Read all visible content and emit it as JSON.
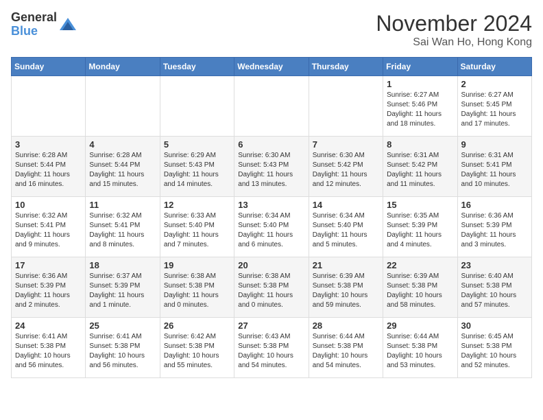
{
  "logo": {
    "general": "General",
    "blue": "Blue"
  },
  "title": {
    "month_year": "November 2024",
    "location": "Sai Wan Ho, Hong Kong"
  },
  "days_of_week": [
    "Sunday",
    "Monday",
    "Tuesday",
    "Wednesday",
    "Thursday",
    "Friday",
    "Saturday"
  ],
  "weeks": [
    [
      {
        "day": "",
        "info": ""
      },
      {
        "day": "",
        "info": ""
      },
      {
        "day": "",
        "info": ""
      },
      {
        "day": "",
        "info": ""
      },
      {
        "day": "",
        "info": ""
      },
      {
        "day": "1",
        "info": "Sunrise: 6:27 AM\nSunset: 5:46 PM\nDaylight: 11 hours and 18 minutes."
      },
      {
        "day": "2",
        "info": "Sunrise: 6:27 AM\nSunset: 5:45 PM\nDaylight: 11 hours and 17 minutes."
      }
    ],
    [
      {
        "day": "3",
        "info": "Sunrise: 6:28 AM\nSunset: 5:44 PM\nDaylight: 11 hours and 16 minutes."
      },
      {
        "day": "4",
        "info": "Sunrise: 6:28 AM\nSunset: 5:44 PM\nDaylight: 11 hours and 15 minutes."
      },
      {
        "day": "5",
        "info": "Sunrise: 6:29 AM\nSunset: 5:43 PM\nDaylight: 11 hours and 14 minutes."
      },
      {
        "day": "6",
        "info": "Sunrise: 6:30 AM\nSunset: 5:43 PM\nDaylight: 11 hours and 13 minutes."
      },
      {
        "day": "7",
        "info": "Sunrise: 6:30 AM\nSunset: 5:42 PM\nDaylight: 11 hours and 12 minutes."
      },
      {
        "day": "8",
        "info": "Sunrise: 6:31 AM\nSunset: 5:42 PM\nDaylight: 11 hours and 11 minutes."
      },
      {
        "day": "9",
        "info": "Sunrise: 6:31 AM\nSunset: 5:41 PM\nDaylight: 11 hours and 10 minutes."
      }
    ],
    [
      {
        "day": "10",
        "info": "Sunrise: 6:32 AM\nSunset: 5:41 PM\nDaylight: 11 hours and 9 minutes."
      },
      {
        "day": "11",
        "info": "Sunrise: 6:32 AM\nSunset: 5:41 PM\nDaylight: 11 hours and 8 minutes."
      },
      {
        "day": "12",
        "info": "Sunrise: 6:33 AM\nSunset: 5:40 PM\nDaylight: 11 hours and 7 minutes."
      },
      {
        "day": "13",
        "info": "Sunrise: 6:34 AM\nSunset: 5:40 PM\nDaylight: 11 hours and 6 minutes."
      },
      {
        "day": "14",
        "info": "Sunrise: 6:34 AM\nSunset: 5:40 PM\nDaylight: 11 hours and 5 minutes."
      },
      {
        "day": "15",
        "info": "Sunrise: 6:35 AM\nSunset: 5:39 PM\nDaylight: 11 hours and 4 minutes."
      },
      {
        "day": "16",
        "info": "Sunrise: 6:36 AM\nSunset: 5:39 PM\nDaylight: 11 hours and 3 minutes."
      }
    ],
    [
      {
        "day": "17",
        "info": "Sunrise: 6:36 AM\nSunset: 5:39 PM\nDaylight: 11 hours and 2 minutes."
      },
      {
        "day": "18",
        "info": "Sunrise: 6:37 AM\nSunset: 5:39 PM\nDaylight: 11 hours and 1 minute."
      },
      {
        "day": "19",
        "info": "Sunrise: 6:38 AM\nSunset: 5:38 PM\nDaylight: 11 hours and 0 minutes."
      },
      {
        "day": "20",
        "info": "Sunrise: 6:38 AM\nSunset: 5:38 PM\nDaylight: 11 hours and 0 minutes."
      },
      {
        "day": "21",
        "info": "Sunrise: 6:39 AM\nSunset: 5:38 PM\nDaylight: 10 hours and 59 minutes."
      },
      {
        "day": "22",
        "info": "Sunrise: 6:39 AM\nSunset: 5:38 PM\nDaylight: 10 hours and 58 minutes."
      },
      {
        "day": "23",
        "info": "Sunrise: 6:40 AM\nSunset: 5:38 PM\nDaylight: 10 hours and 57 minutes."
      }
    ],
    [
      {
        "day": "24",
        "info": "Sunrise: 6:41 AM\nSunset: 5:38 PM\nDaylight: 10 hours and 56 minutes."
      },
      {
        "day": "25",
        "info": "Sunrise: 6:41 AM\nSunset: 5:38 PM\nDaylight: 10 hours and 56 minutes."
      },
      {
        "day": "26",
        "info": "Sunrise: 6:42 AM\nSunset: 5:38 PM\nDaylight: 10 hours and 55 minutes."
      },
      {
        "day": "27",
        "info": "Sunrise: 6:43 AM\nSunset: 5:38 PM\nDaylight: 10 hours and 54 minutes."
      },
      {
        "day": "28",
        "info": "Sunrise: 6:44 AM\nSunset: 5:38 PM\nDaylight: 10 hours and 54 minutes."
      },
      {
        "day": "29",
        "info": "Sunrise: 6:44 AM\nSunset: 5:38 PM\nDaylight: 10 hours and 53 minutes."
      },
      {
        "day": "30",
        "info": "Sunrise: 6:45 AM\nSunset: 5:38 PM\nDaylight: 10 hours and 52 minutes."
      }
    ]
  ]
}
